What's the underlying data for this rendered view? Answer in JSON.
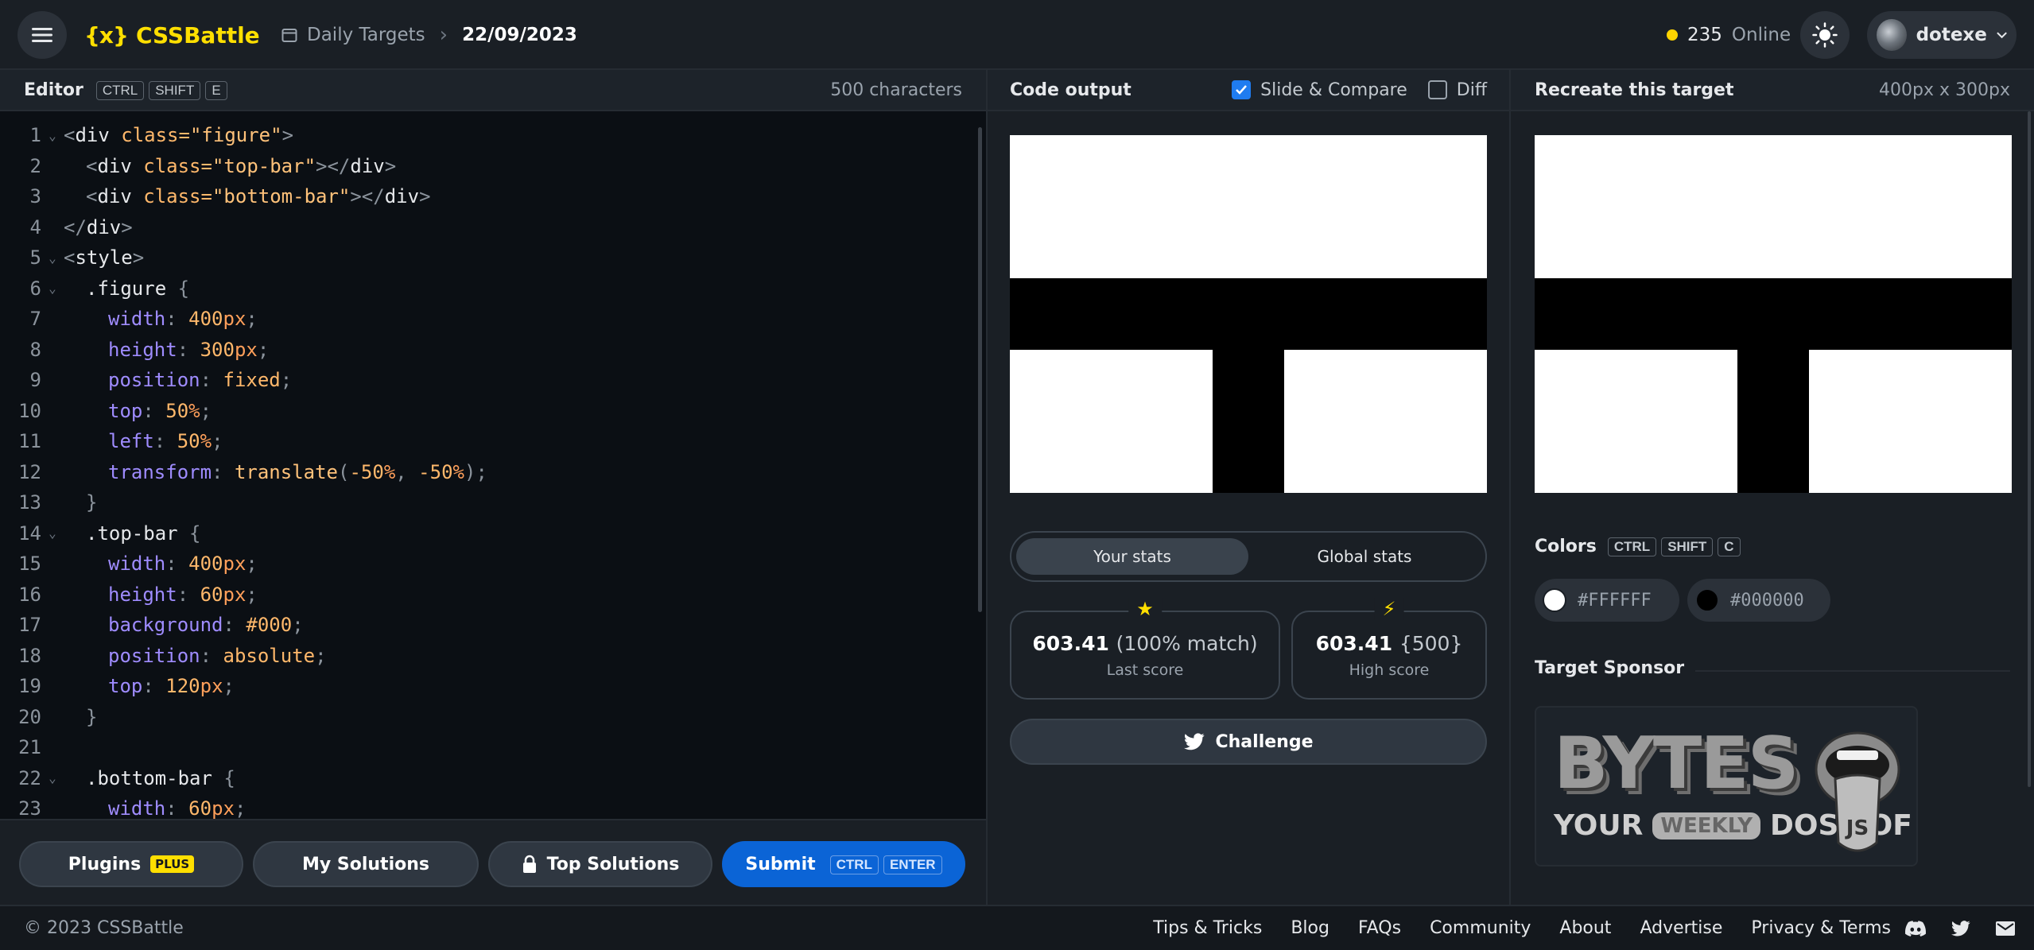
{
  "header": {
    "logo_mark": "{x}",
    "logo_text": "CSSBattle",
    "breadcrumb_link": "Daily Targets",
    "breadcrumb_current": "22/09/2023",
    "online_count": "235",
    "online_label": "Online",
    "username": "dotexe"
  },
  "editor": {
    "title": "Editor",
    "shortcut": [
      "CTRL",
      "SHIFT",
      "E"
    ],
    "char_count": "500 characters",
    "line_numbers": [
      "1",
      "2",
      "3",
      "4",
      "5",
      "6",
      "7",
      "8",
      "9",
      "10",
      "11",
      "12",
      "13",
      "14",
      "15",
      "16",
      "17",
      "18",
      "19",
      "20",
      "21",
      "22",
      "23"
    ],
    "code": {
      "l1": {
        "a": "<",
        "b": "div",
        "c": " class=",
        "d": "\"figure\"",
        "e": ">"
      },
      "l2": {
        "a": "<",
        "b": "div",
        "c": " class=",
        "d": "\"top-bar\"",
        "e": "></",
        "f": "div",
        "g": ">"
      },
      "l3": {
        "a": "<",
        "b": "div",
        "c": " class=",
        "d": "\"bottom-bar\"",
        "e": "></",
        "f": "div",
        "g": ">"
      },
      "l4": {
        "a": "</",
        "b": "div",
        "e": ">"
      },
      "l5": {
        "a": "<",
        "b": "style",
        "e": ">"
      },
      "l6": {
        "sel": ".figure",
        "brace": " {"
      },
      "l7": {
        "prop": "width",
        "colon": ": ",
        "num": "400",
        "unit": "px",
        "semi": ";"
      },
      "l8": {
        "prop": "height",
        "colon": ": ",
        "num": "300",
        "unit": "px",
        "semi": ";"
      },
      "l9": {
        "prop": "position",
        "colon": ": ",
        "num": "fixed",
        "semi": ";"
      },
      "l10": {
        "prop": "top",
        "colon": ": ",
        "num": "50",
        "unit": "%",
        "semi": ";"
      },
      "l11": {
        "prop": "left",
        "colon": ": ",
        "num": "50",
        "unit": "%",
        "semi": ";"
      },
      "l12": {
        "prop": "transform",
        "colon": ": ",
        "fn": "translate",
        "open": "(",
        "n1": "-50",
        "u1": "%",
        "comma": ", ",
        "n2": "-50",
        "u2": "%",
        "close": ")",
        "semi": ";"
      },
      "l13": {
        "brace": "}"
      },
      "l14": {
        "sel": ".top-bar",
        "brace": " {"
      },
      "l15": {
        "prop": "width",
        "colon": ": ",
        "num": "400",
        "unit": "px",
        "semi": ";"
      },
      "l16": {
        "prop": "height",
        "colon": ": ",
        "num": "60",
        "unit": "px",
        "semi": ";"
      },
      "l17": {
        "prop": "background",
        "colon": ": ",
        "num": "#000",
        "semi": ";"
      },
      "l18": {
        "prop": "position",
        "colon": ": ",
        "num": "absolute",
        "semi": ";"
      },
      "l19": {
        "prop": "top",
        "colon": ": ",
        "num": "120",
        "unit": "px",
        "semi": ";"
      },
      "l20": {
        "brace": "}"
      },
      "l22": {
        "sel": ".bottom-bar",
        "brace": " {"
      },
      "l23": {
        "prop": "width",
        "colon": ": ",
        "num": "60",
        "unit": "px",
        "semi": ";"
      }
    }
  },
  "editor_footer": {
    "plugins_label": "Plugins",
    "plugins_badge": "PLUS",
    "my_solutions_label": "My Solutions",
    "top_solutions_label": "Top Solutions",
    "submit_label": "Submit",
    "submit_keys": [
      "CTRL",
      "ENTER"
    ]
  },
  "output": {
    "title": "Code output",
    "slide_compare_label": "Slide & Compare",
    "slide_compare_checked": true,
    "diff_label": "Diff",
    "diff_checked": false
  },
  "stats": {
    "tab_your": "Your stats",
    "tab_global": "Global stats",
    "last_score_value": "603.41",
    "last_score_extra": "(100% match)",
    "last_score_label": "Last score",
    "high_score_value": "603.41",
    "high_score_extra": "{500}",
    "high_score_label": "High score",
    "challenge_label": "Challenge"
  },
  "target": {
    "title": "Recreate this target",
    "size": "400px x 300px",
    "colors_title": "Colors",
    "colors_shortcut": [
      "CTRL",
      "SHIFT",
      "C"
    ],
    "colors": [
      "#FFFFFF",
      "#000000"
    ],
    "sponsor_title": "Target Sponsor",
    "sponsor_logo_big": "BYTES",
    "sponsor_logo_your": "YOUR",
    "sponsor_logo_weekly": "WEEKLY",
    "sponsor_logo_dose": "DOSE OF",
    "sponsor_logo_js": "JS"
  },
  "footer": {
    "copyright": "© 2023 CSSBattle",
    "links": [
      "Tips & Tricks",
      "Blog",
      "FAQs",
      "Community",
      "About",
      "Advertise",
      "Privacy & Terms"
    ]
  },
  "colors": {
    "accent_yellow": "#ffdf00",
    "submit_blue": "#0b64d6",
    "background": "#14181d"
  }
}
